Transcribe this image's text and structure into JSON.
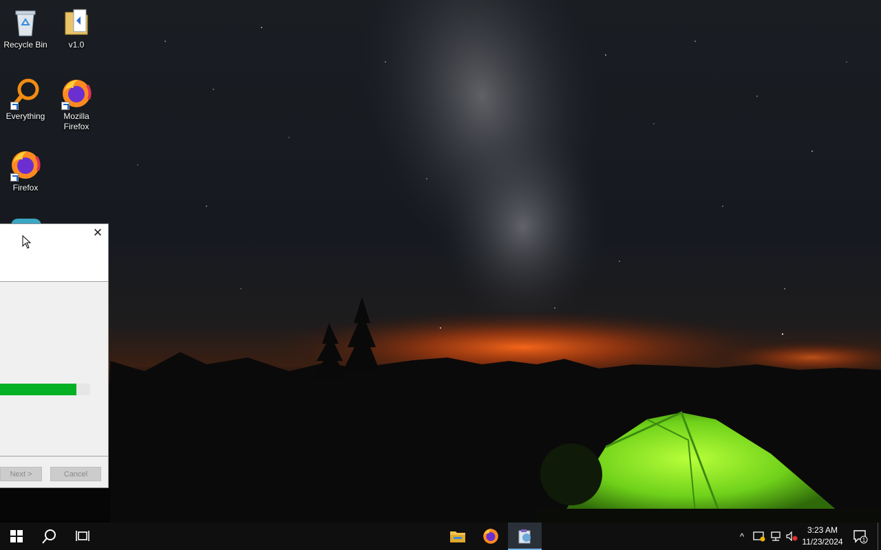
{
  "desktop": {
    "icons": [
      {
        "label": "Recycle Bin",
        "icon": "recycle-bin-icon"
      },
      {
        "label": "v1.0",
        "icon": "folder-icon"
      },
      {
        "label": "Everything",
        "icon": "everything-search-icon"
      },
      {
        "label": "Mozilla Firefox",
        "icon": "firefox-icon"
      },
      {
        "label": "Firefox",
        "icon": "firefox-icon"
      }
    ]
  },
  "installer": {
    "close_glyph": "✕",
    "progress_fraction": 0.85,
    "next_label": "Next >",
    "cancel_label": "Cancel",
    "progress_color": "#06b025"
  },
  "taskbar": {
    "pinned": [
      {
        "icon": "windows-start-icon"
      },
      {
        "icon": "search-icon"
      },
      {
        "icon": "task-view-icon"
      },
      {
        "icon": "file-explorer-icon"
      },
      {
        "icon": "firefox-icon"
      },
      {
        "icon": "installer-app-icon",
        "active": true
      }
    ],
    "tray": {
      "overflow_glyph": "^",
      "time": "3:23 AM",
      "date": "11/23/2024",
      "notification_count": "1"
    }
  }
}
